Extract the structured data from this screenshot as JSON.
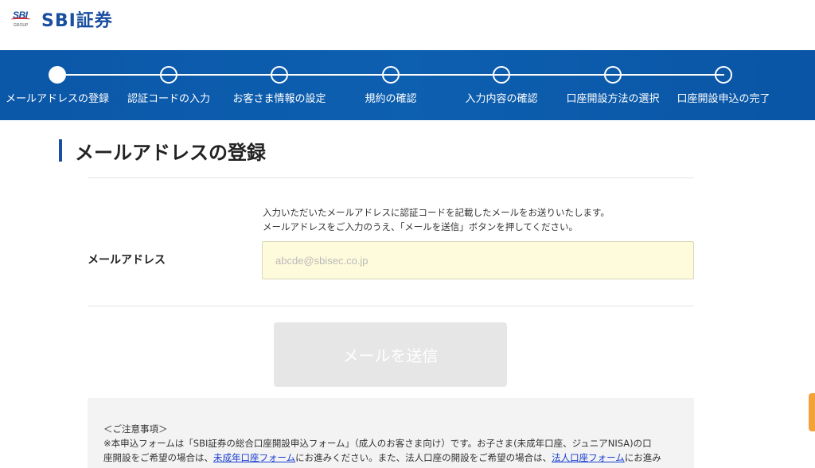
{
  "header": {
    "logo_mark_text": "SBI",
    "logo_group_text": "GROUP",
    "logo_text": "SBI証券"
  },
  "steps": [
    {
      "label": "メールアドレスの登録",
      "active": true
    },
    {
      "label": "認証コードの入力",
      "active": false
    },
    {
      "label": "お客さま情報の設定",
      "active": false
    },
    {
      "label": "規約の確認",
      "active": false
    },
    {
      "label": "入力内容の確認",
      "active": false
    },
    {
      "label": "口座開設方法の選択",
      "active": false
    },
    {
      "label": "口座開設申込の完了",
      "active": false
    }
  ],
  "page": {
    "title": "メールアドレスの登録"
  },
  "form": {
    "description_line1": "入力いただいたメールアドレスに認証コードを記載したメールをお送りいたします。",
    "description_line2": "メールアドレスをご入力のうえ、「メールを送信」ボタンを押してください。",
    "email_label": "メールアドレス",
    "email_placeholder": "abcde@sbisec.co.jp",
    "email_value": "",
    "send_button_label": "メールを送信"
  },
  "notice": {
    "heading": "＜ご注意事項＞",
    "line1": "※本申込フォームは「SBI証券の総合口座開設申込フォーム」（成人のお客さま向け）です。お子さま(未成年口座、ジュニアNISA)の口",
    "line2_a": "座開設をご希望の場合は、",
    "link_minor": "未成年口座フォーム",
    "line2_b": "にお進みください。また、法人口座の開設をご希望の場合は、",
    "link_corp": "法人口座フォーム",
    "line2_c": "にお進み"
  },
  "colors": {
    "brand_blue": "#1a4fa0",
    "band_blue": "#0b57a8",
    "input_bg": "#fefbdc",
    "disabled_button": "#e6e6e6",
    "link": "#1a3fcf",
    "side_tab": "#f5a13a"
  }
}
